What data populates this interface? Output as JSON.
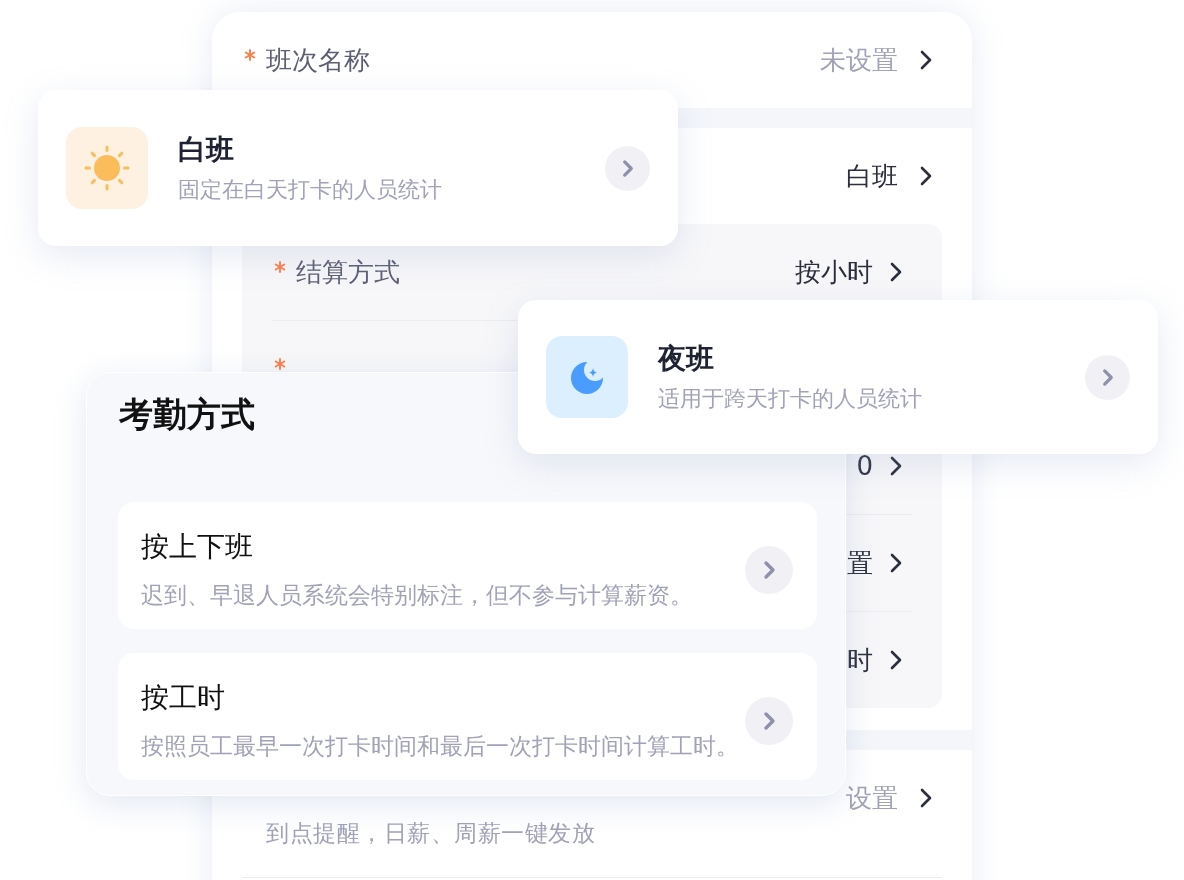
{
  "shift_form": {
    "sections": [
      {
        "rows": [
          {
            "required": true,
            "label": "班次名称",
            "placeholder": "未设置"
          }
        ]
      },
      {
        "rows": [
          {
            "value": "白班"
          }
        ],
        "group_rows": [
          {
            "required": true,
            "label": "结算方式",
            "value": "按小时"
          },
          {
            "required": true
          },
          {
            "value": "0"
          },
          {
            "value": "置"
          },
          {
            "value": "时"
          }
        ]
      },
      {
        "rows": [
          {
            "placeholder": "设置",
            "hint": "到点提醒，日薪、周薪一键发放"
          }
        ]
      }
    ]
  },
  "shift_cards": [
    {
      "kind": "day",
      "title": "白班",
      "description": "固定在白天打卡的人员统计"
    },
    {
      "kind": "night",
      "title": "夜班",
      "description": "适用于跨天打卡的人员统计"
    }
  ],
  "attendance_sheet": {
    "title": "考勤方式",
    "options": [
      {
        "title": "按上下班",
        "description": "迟到、早退人员系统会特别标注，但不参与计算薪资。"
      },
      {
        "title": "按工时",
        "description": "按照员工最早一次打卡时间和最后一次打卡时间计算工时。"
      }
    ]
  }
}
